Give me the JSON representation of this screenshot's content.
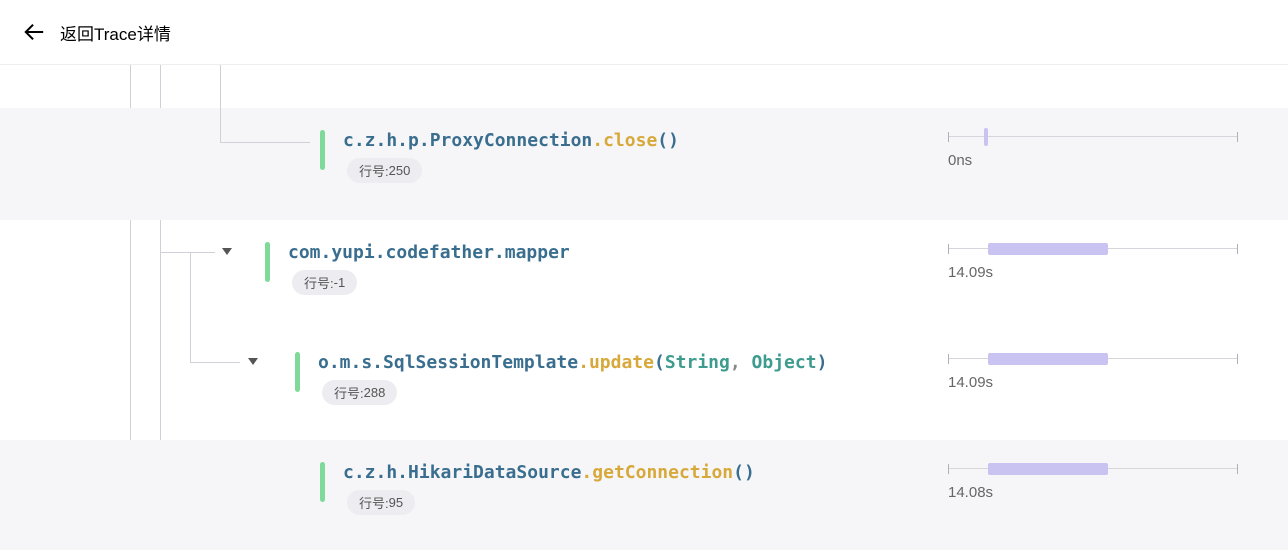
{
  "header": {
    "back_label": "返回Trace详情"
  },
  "line_prefix": "行号: ",
  "rows": [
    {
      "class": "c.z.h.p.ProxyConnection",
      "method": "close",
      "args": [],
      "line": "250",
      "duration": "0ns"
    },
    {
      "class": "com.yupi.codefather.mapper",
      "method": "",
      "args": [],
      "line": "-1",
      "duration": "14.09s"
    },
    {
      "class": "o.m.s.SqlSessionTemplate",
      "method": "update",
      "args": [
        "String",
        "Object"
      ],
      "line": "288",
      "duration": "14.09s"
    },
    {
      "class": "c.z.h.HikariDataSource",
      "method": "getConnection",
      "args": [],
      "line": "95",
      "duration": "14.08s"
    }
  ]
}
